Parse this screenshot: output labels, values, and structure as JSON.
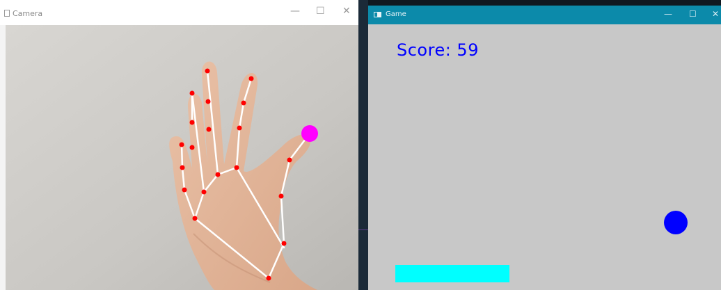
{
  "camera_window": {
    "title": "Camera",
    "controls": {
      "minimize": "—",
      "maximize": "☐",
      "close": "✕"
    }
  },
  "game_window": {
    "title": "Game",
    "controls": {
      "minimize": "—",
      "maximize": "☐",
      "close": "✕"
    },
    "score_text": "Score: 59"
  },
  "colors": {
    "score": "#0000ff",
    "ball": "#0000ff",
    "paddle": "#00ffff",
    "fingertip_marker": "#ff00ff",
    "landmark": "#ff0000",
    "skeleton": "#ffffff",
    "game_titlebar": "#0c8aaa",
    "game_background": "#c8c8c8"
  },
  "icons": [
    "window-icon",
    "minimize-icon",
    "maximize-icon",
    "close-icon"
  ]
}
